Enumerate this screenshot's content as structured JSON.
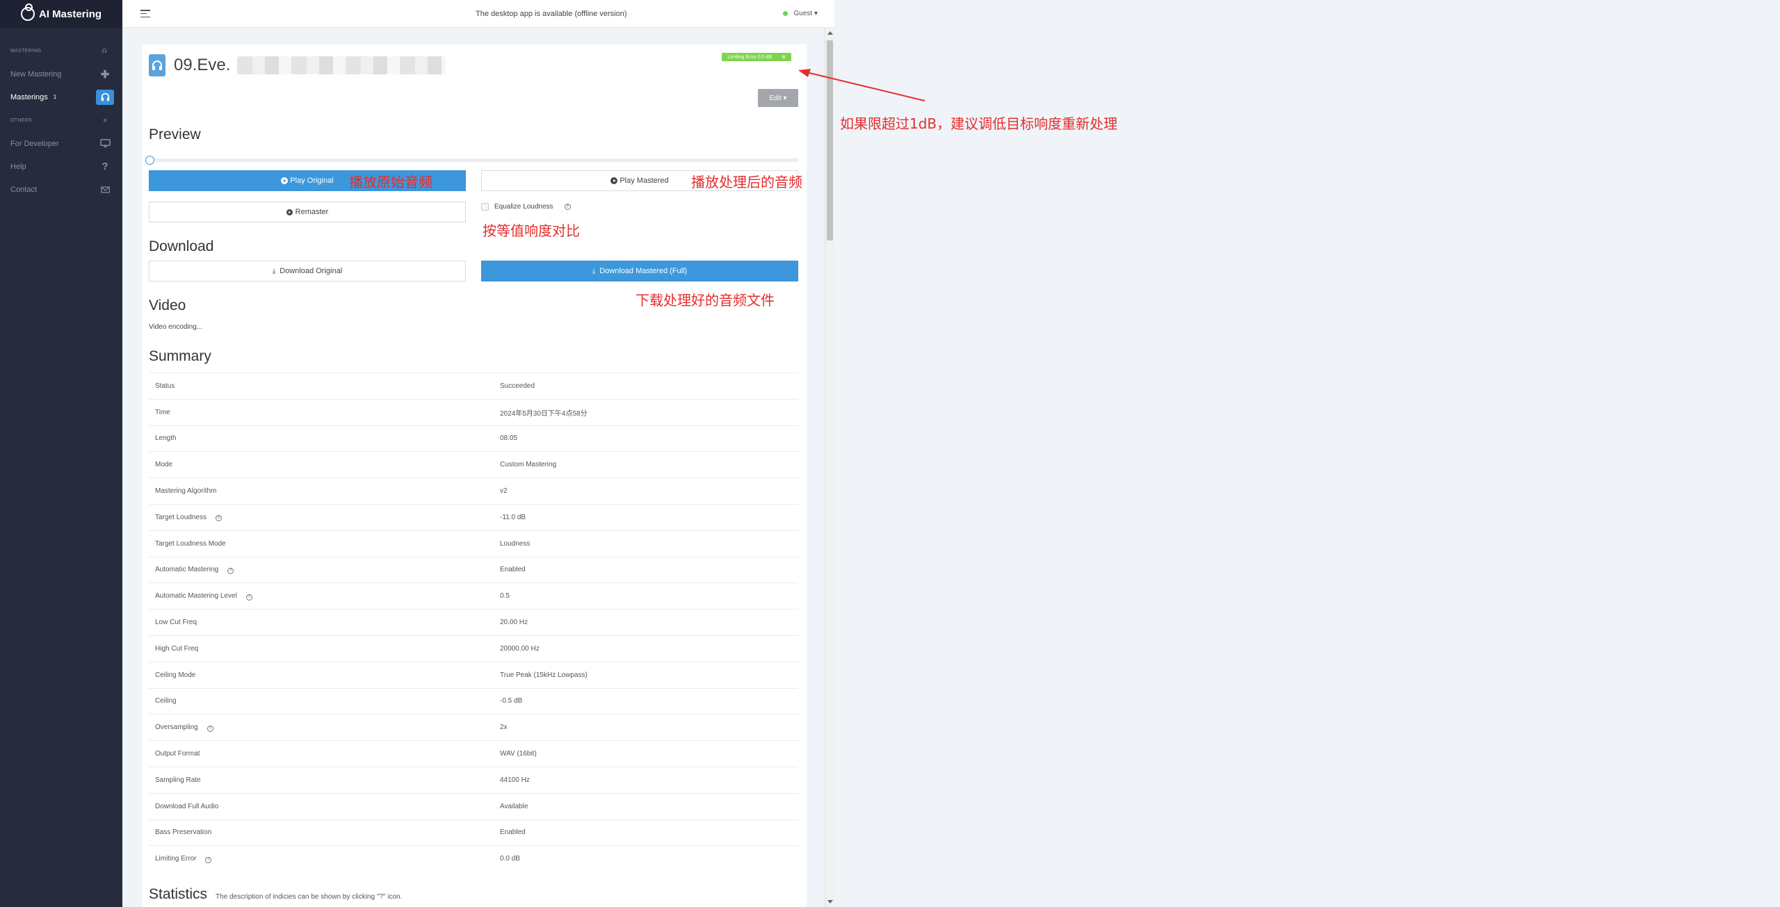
{
  "sidebar": {
    "brand": "AI Mastering",
    "section_mastering": "MASTERING",
    "section_others": "OTHERS",
    "items": [
      {
        "label": "New Mastering",
        "icon": "plus-icon"
      },
      {
        "label": "Masterings",
        "badge": "1",
        "icon": "headphones-icon"
      },
      {
        "label": "For Developer",
        "icon": "monitor-icon"
      },
      {
        "label": "Help",
        "icon": "question-icon"
      },
      {
        "label": "Contact",
        "icon": "mail-icon"
      }
    ]
  },
  "topbar": {
    "message": "The desktop app is available (offline version)",
    "user": "Guest ▾"
  },
  "file": {
    "name": "09.Eve.",
    "limit_badge": "Limiting Error 0.0 dB",
    "edit_label": "Edit ▾"
  },
  "preview": {
    "title": "Preview",
    "play_original": "Play Original",
    "play_mastered": "Play Mastered",
    "remaster": "Remaster",
    "equalize": "Equalize Loudness"
  },
  "download": {
    "title": "Download",
    "original": "Download Original",
    "mastered": "Download Mastered (Full)"
  },
  "video": {
    "title": "Video",
    "status": "Video encoding..."
  },
  "summary": {
    "title": "Summary",
    "rows": [
      {
        "label": "Status",
        "value": "Succeeded",
        "help": false
      },
      {
        "label": "Time",
        "value": "2024年5月30日下午4点58分",
        "help": false
      },
      {
        "label": "Length",
        "value": "08:05",
        "help": false
      },
      {
        "label": "Mode",
        "value": "Custom Mastering",
        "help": false
      },
      {
        "label": "Mastering Algorithm",
        "value": "v2",
        "help": false
      },
      {
        "label": "Target Loudness",
        "value": "-11.0 dB",
        "help": true
      },
      {
        "label": "Target Loudness Mode",
        "value": "Loudness",
        "help": false
      },
      {
        "label": "Automatic Mastering",
        "value": "Enabled",
        "help": true
      },
      {
        "label": "Automatic Mastering Level",
        "value": "0.5",
        "help": true
      },
      {
        "label": "Low Cut Freq",
        "value": "20.00 Hz",
        "help": false
      },
      {
        "label": "High Cut Freq",
        "value": "20000.00 Hz",
        "help": false
      },
      {
        "label": "Ceiling Mode",
        "value": "True Peak (15kHz Lowpass)",
        "help": false
      },
      {
        "label": "Ceiling",
        "value": "-0.5 dB",
        "help": false
      },
      {
        "label": "Oversampling",
        "value": "2x",
        "help": true
      },
      {
        "label": "Output Format",
        "value": "WAV (16bit)",
        "help": false
      },
      {
        "label": "Sampling Rate",
        "value": "44100 Hz",
        "help": false
      },
      {
        "label": "Download Full Audio",
        "value": "Available",
        "help": false
      },
      {
        "label": "Bass Preservation",
        "value": "Enabled",
        "help": false
      },
      {
        "label": "Limiting Error",
        "value": "0.0 dB",
        "help": true
      }
    ]
  },
  "statistics": {
    "title": "Statistics",
    "desc": "The description of indicies can be shown by clicking \"?\" icon."
  },
  "annotations": {
    "limit_note": "如果限超过1dB，建议调低目标响度重新处理",
    "play_original_note": "播放原始音频",
    "play_mastered_note": "播放处理后的音频",
    "equalize_note": "按等值响度对比",
    "download_note": "下载处理好的音频文件"
  },
  "colors": {
    "sidebar": "#262b3d",
    "accent": "#3d98db",
    "badge_green": "#7ed44e",
    "annotation_red": "#e52d2d"
  }
}
